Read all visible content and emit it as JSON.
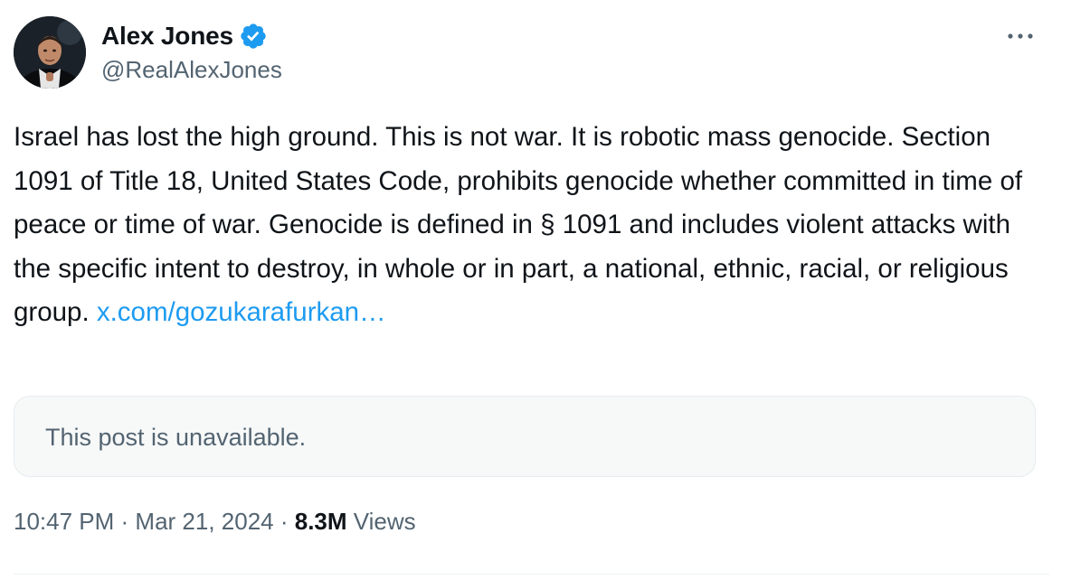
{
  "author": {
    "display_name": "Alex Jones",
    "handle": "@RealAlexJones",
    "verified": true
  },
  "tweet": {
    "text": "Israel has lost the high ground. This is not war. It is robotic mass genocide. Section 1091 of Title 18, United States Code, prohibits genocide whether committed in time of peace or time of war. Genocide is defined in § 1091 and includes violent attacks with the specific intent to destroy, in whole or in part, a national, ethnic, racial, or religious group.",
    "link_text": "x.com/gozukarafurkan…"
  },
  "quoted_post": {
    "message": "This post is unavailable."
  },
  "meta": {
    "time": "10:47 PM",
    "separator": " · ",
    "date": "Mar 21, 2024",
    "views_count": "8.3M",
    "views_label": "Views"
  },
  "icons": {
    "verified": "verified-badge-icon",
    "more": "more-options-icon"
  },
  "colors": {
    "link": "#1d9bf0",
    "verified": "#1d9bf0",
    "secondary_text": "#536471",
    "primary_text": "#0f1419",
    "card_background": "#f7f9f9"
  }
}
